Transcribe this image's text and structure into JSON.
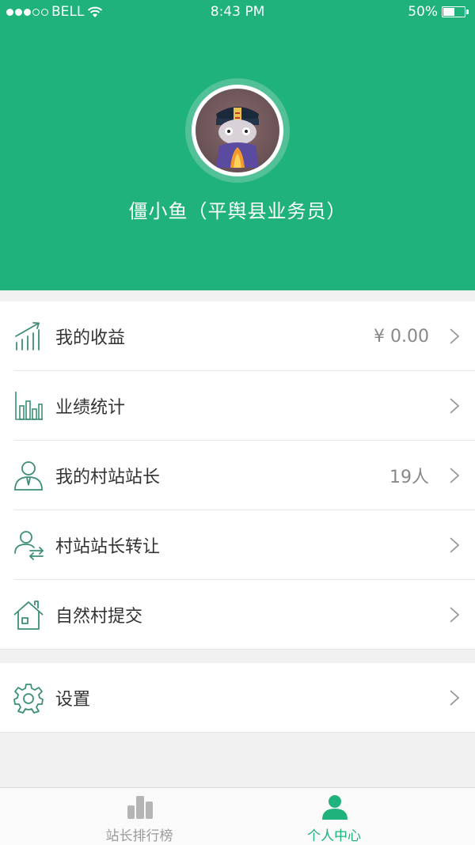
{
  "status_bar": {
    "carrier": "BELL",
    "time": "8:43 PM",
    "battery": "50%",
    "battery_level": 0.5
  },
  "profile": {
    "name": "僵小鱼（平舆县业务员）"
  },
  "menu": [
    {
      "label": "我的收益",
      "value": "¥ 0.00",
      "icon": "growth-chart-icon"
    },
    {
      "label": "业绩统计",
      "value": "",
      "icon": "bar-stats-icon"
    },
    {
      "label": "我的村站站长",
      "value": "19人",
      "icon": "person-tie-icon"
    },
    {
      "label": "村站站长转让",
      "value": "",
      "icon": "person-transfer-icon"
    },
    {
      "label": "自然村提交",
      "value": "",
      "icon": "house-icon"
    }
  ],
  "settings": {
    "label": "设置",
    "icon": "gear-icon"
  },
  "tabs": [
    {
      "label": "站长排行榜",
      "icon": "ranking-icon",
      "active": false
    },
    {
      "label": "个人中心",
      "icon": "person-icon",
      "active": true
    }
  ],
  "colors": {
    "brand": "#1fb27a",
    "tab_active": "#1fb27a",
    "tab_inactive": "#9a9a9a"
  }
}
